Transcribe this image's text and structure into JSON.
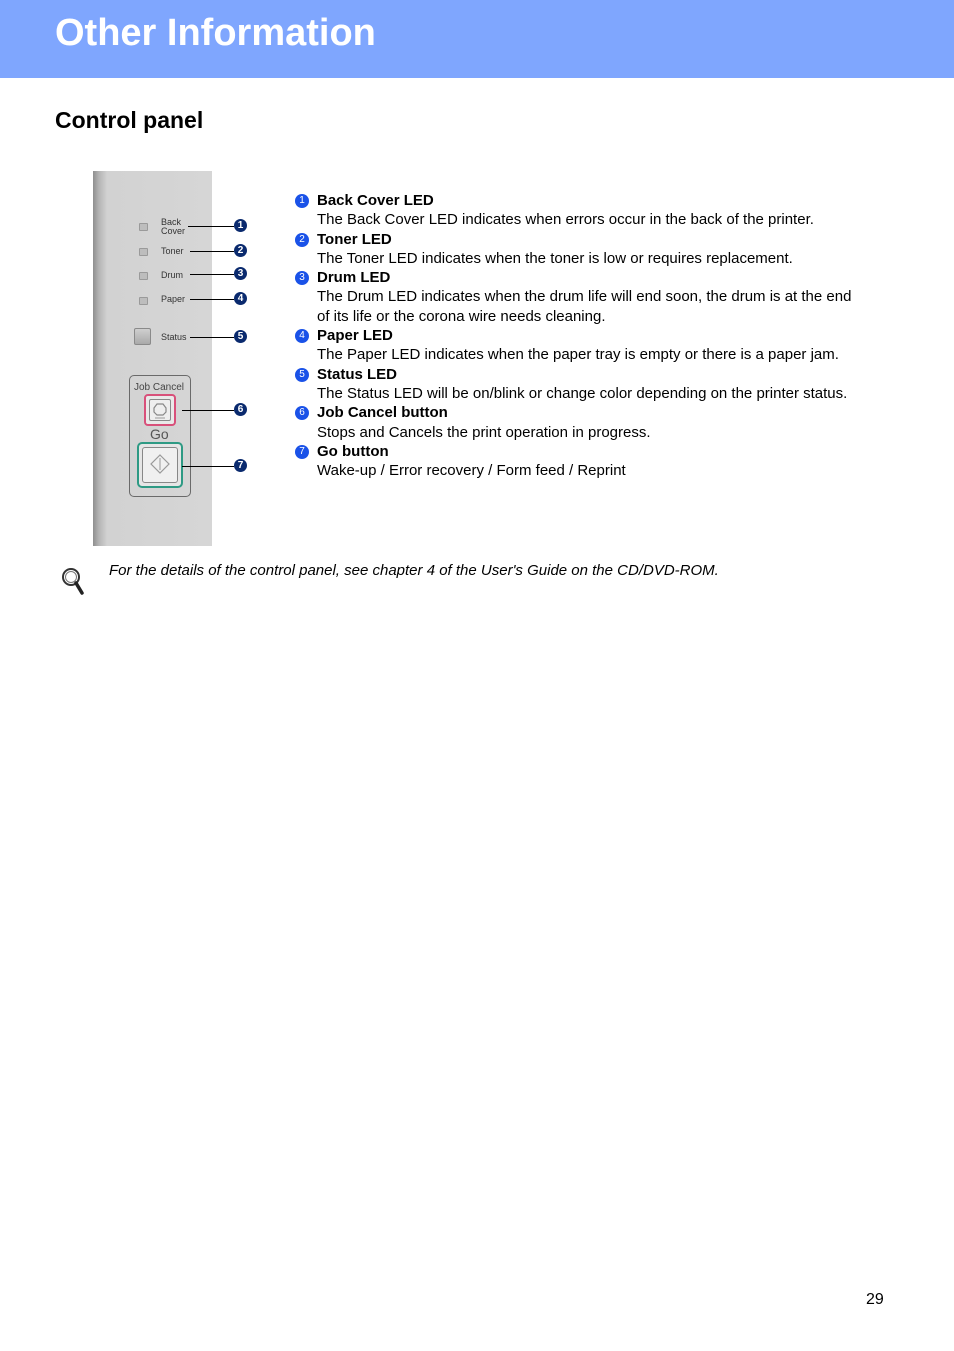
{
  "header": {
    "title": "Other Information",
    "banner_color": "#7fa6fe"
  },
  "section": {
    "title": "Control panel"
  },
  "panel_image": {
    "leds": [
      {
        "label_line1": "Back",
        "label_line2": "Cover",
        "callout": "1"
      },
      {
        "label_line1": "Toner",
        "callout": "2"
      },
      {
        "label_line1": "Drum",
        "callout": "3"
      },
      {
        "label_line1": "Paper",
        "callout": "4"
      },
      {
        "label_line1": "Status",
        "callout": "5"
      }
    ],
    "job_cancel_label": "Job Cancel",
    "job_cancel_callout": "6",
    "go_label": "Go",
    "go_callout": "7"
  },
  "items": [
    {
      "num": "1",
      "title": "Back Cover LED",
      "desc": "The Back Cover LED indicates when errors occur in the back of the printer."
    },
    {
      "num": "2",
      "title": "Toner LED",
      "desc": "The Toner LED indicates when the toner is low or requires replacement."
    },
    {
      "num": "3",
      "title": "Drum LED",
      "desc": "The Drum LED indicates when the drum life will end soon, the drum is at the end of its life or the corona wire needs cleaning."
    },
    {
      "num": "4",
      "title": "Paper LED",
      "desc": "The Paper LED indicates when the paper tray is empty or there is a paper jam."
    },
    {
      "num": "5",
      "title": "Status LED",
      "desc": "The Status LED will be on/blink or change color depending on the printer status."
    },
    {
      "num": "6",
      "title": "Job Cancel button",
      "desc": "Stops and Cancels the print operation in progress."
    },
    {
      "num": "7",
      "title": "Go button",
      "desc": "Wake-up / Error recovery / Form feed / Reprint"
    }
  ],
  "note": {
    "icon": "magnifier-icon",
    "text": "For the details of the control panel, see chapter 4 of the User's Guide on the CD/DVD-ROM."
  },
  "footer": {
    "page_number": "29"
  }
}
